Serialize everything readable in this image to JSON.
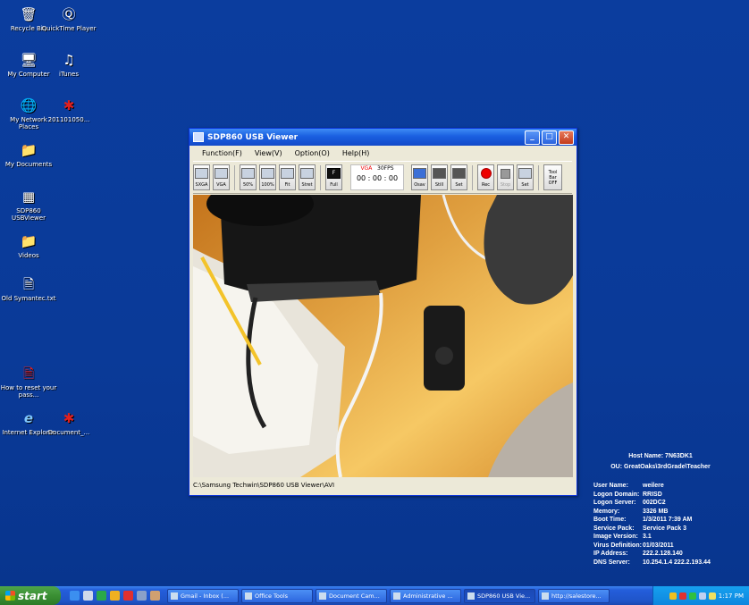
{
  "desktop_icons": [
    {
      "label": "Recycle Bin",
      "icon": "recycle-bin-icon"
    },
    {
      "label": "QuickTime Player",
      "icon": "quicktime-icon"
    },
    {
      "label": "My Computer",
      "icon": "my-computer-icon"
    },
    {
      "label": "iTunes",
      "icon": "itunes-icon"
    },
    {
      "label": "My Network Places",
      "icon": "network-icon"
    },
    {
      "label": "201101050...",
      "icon": "bug-icon"
    },
    {
      "label": "My Documents",
      "icon": "documents-icon"
    },
    {
      "label": "SDP860 USBViewer",
      "icon": "app-icon"
    },
    {
      "label": "Videos",
      "icon": "folder-icon"
    },
    {
      "label": "Old Symantec.txt",
      "icon": "text-file-icon"
    },
    {
      "label": "How to reset your pass...",
      "icon": "pdf-icon"
    },
    {
      "label": "Internet Explorer",
      "icon": "ie-icon"
    },
    {
      "label": "Document_...",
      "icon": "bug-icon"
    }
  ],
  "window": {
    "title": "SDP860 USB Viewer",
    "menu": [
      "Function(F)",
      "View(V)",
      "Option(O)",
      "Help(H)"
    ],
    "toolbar": {
      "sxga": "SXGA",
      "vga": "VGA",
      "p50": "50%",
      "p100": "100%",
      "fit": "Fit",
      "stret": "Stret",
      "full": "Full",
      "mode": "VGA",
      "fps": "30FPS",
      "time": "00 : 00 : 00",
      "osav": "Osav",
      "still": "Still",
      "set": "Set",
      "rec": "Rec",
      "stop": "Stop",
      "set2": "Set",
      "toolbar_off": "Tool Bar OFF"
    },
    "path": "C:\\Samsung Techwin\\SDP860 USB Viewer\\AVI"
  },
  "sysinfo": {
    "host": "Host Name: 7N63DK1",
    "ou": "OU: GreatOaks\\3rdGrade\\Teacher",
    "rows": [
      [
        "User Name:",
        "weilere"
      ],
      [
        "Logon Domain:",
        "RRISD"
      ],
      [
        "Logon Server:",
        "002DC2"
      ],
      [
        "Memory:",
        "3326 MB"
      ],
      [
        "Boot Time:",
        "1/3/2011 7:39 AM"
      ],
      [
        "Service Pack:",
        "Service Pack 3"
      ],
      [
        "Image Version:",
        "3.1"
      ],
      [
        "Virus Definition:",
        "01/03/2011"
      ],
      [
        "IP Address:",
        "222.2.128.140"
      ],
      [
        "DNS Server:",
        "10.254.1.4 222.2.193.44"
      ]
    ]
  },
  "taskbar": {
    "start": "start",
    "tasks": [
      "Gmail - Inbox (...",
      "Office Tools",
      "Document Cam...",
      "Administrative ...",
      "SDP860 USB Vie...",
      "http://salestore..."
    ],
    "clock": "1:17 PM"
  }
}
